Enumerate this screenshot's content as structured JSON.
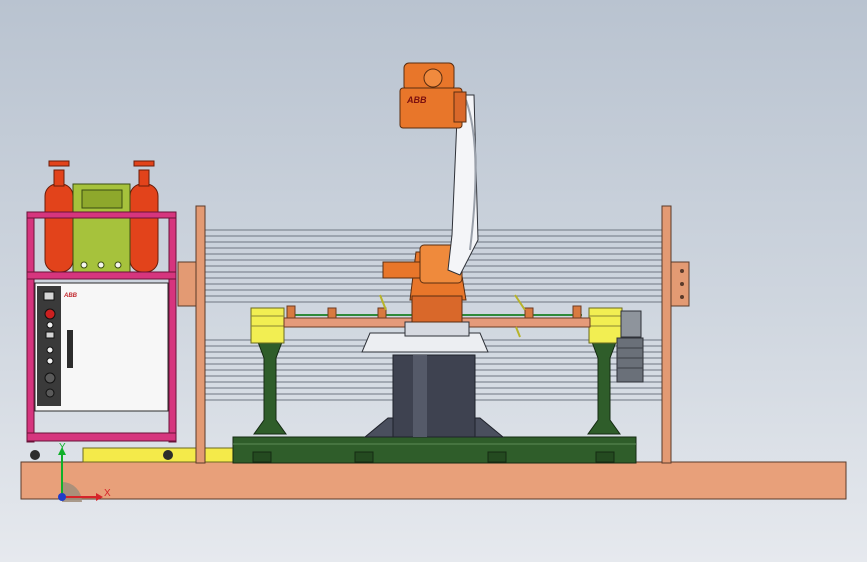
{
  "robot": {
    "brand": "ABB"
  },
  "cabinet": {
    "brand": "ABB"
  },
  "triad": {
    "x_label": "X",
    "y_label": "Y"
  },
  "colors": {
    "background_top": "#b9c3d0",
    "floor": "#e8a07a",
    "robot_orange": "#e8762a",
    "frame_pink": "#d6357e",
    "gas_red": "#e2431b",
    "panel_green": "#a6c23c",
    "base_green": "#2f5d2a",
    "positioner_yellow": "#f2ee52",
    "pillar_dark": "#3e4250"
  }
}
